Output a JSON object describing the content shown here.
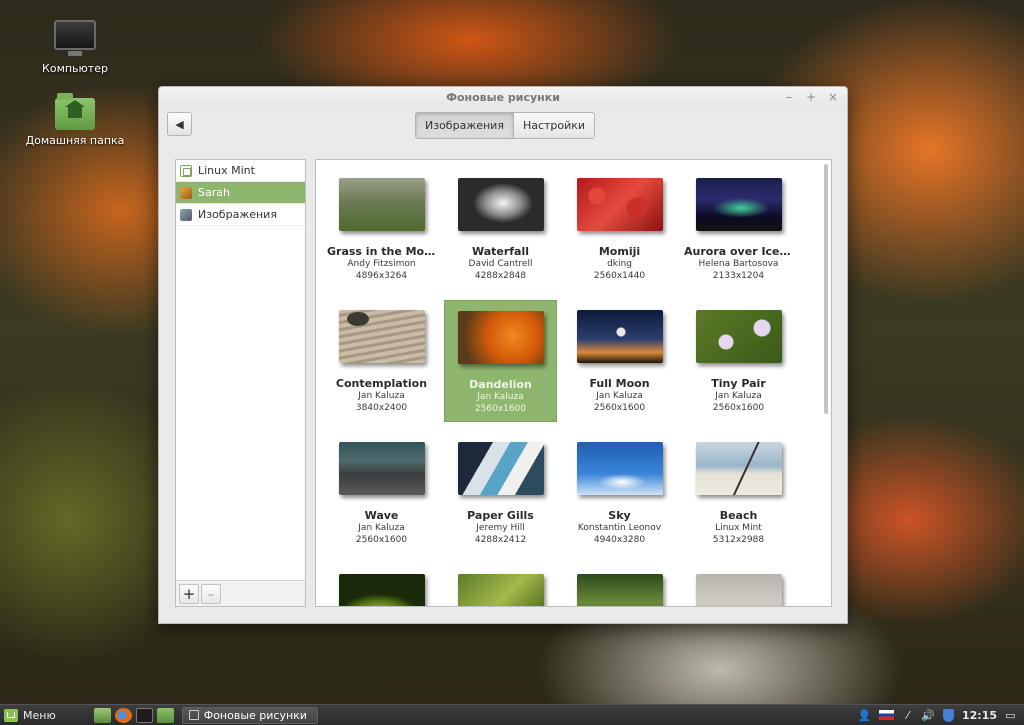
{
  "desktop": {
    "icons": [
      {
        "label": "Компьютер"
      },
      {
        "label": "Домашняя папка"
      }
    ]
  },
  "window": {
    "title": "Фоновые рисунки",
    "controls": {
      "minimize": "–",
      "maximize": "+",
      "close": "×"
    },
    "tabs": [
      {
        "label": "Изображения",
        "active": true
      },
      {
        "label": "Настройки",
        "active": false
      }
    ]
  },
  "sidebar": {
    "items": [
      {
        "label": "Linux Mint",
        "icon": "mint-icon"
      },
      {
        "label": "Sarah",
        "icon": "user-icon",
        "selected": true
      },
      {
        "label": "Изображения",
        "icon": "pictures-icon"
      }
    ],
    "add_label": "+",
    "remove_label": "–"
  },
  "wallpapers": [
    {
      "name": "Grass in the Morn...",
      "author": "Andy Fitzsimon",
      "size": "4896x3264"
    },
    {
      "name": "Waterfall",
      "author": "David Cantrell",
      "size": "4288x2848"
    },
    {
      "name": "Momiji",
      "author": "dking",
      "size": "2560x1440"
    },
    {
      "name": "Aurora over Icela...",
      "author": "Helena Bartosova",
      "size": "2133x1204"
    },
    {
      "name": "Contemplation",
      "author": "Jan Kaluza",
      "size": "3840x2400"
    },
    {
      "name": "Dandelion",
      "author": "Jan Kaluza",
      "size": "2560x1600",
      "selected": true
    },
    {
      "name": "Full Moon",
      "author": "Jan Kaluza",
      "size": "2560x1600"
    },
    {
      "name": "Tiny Pair",
      "author": "Jan Kaluza",
      "size": "2560x1600"
    },
    {
      "name": "Wave",
      "author": "Jan Kaluza",
      "size": "2560x1600"
    },
    {
      "name": "Paper Gills",
      "author": "Jeremy Hill",
      "size": "4288x2412"
    },
    {
      "name": "Sky",
      "author": "Konstantin Leonov",
      "size": "4940x3280"
    },
    {
      "name": "Beach",
      "author": "Linux Mint",
      "size": "5312x2988"
    }
  ],
  "taskbar": {
    "menu_label": "Меню",
    "active_window": "Фоновые рисунки",
    "clock": "12:15"
  }
}
